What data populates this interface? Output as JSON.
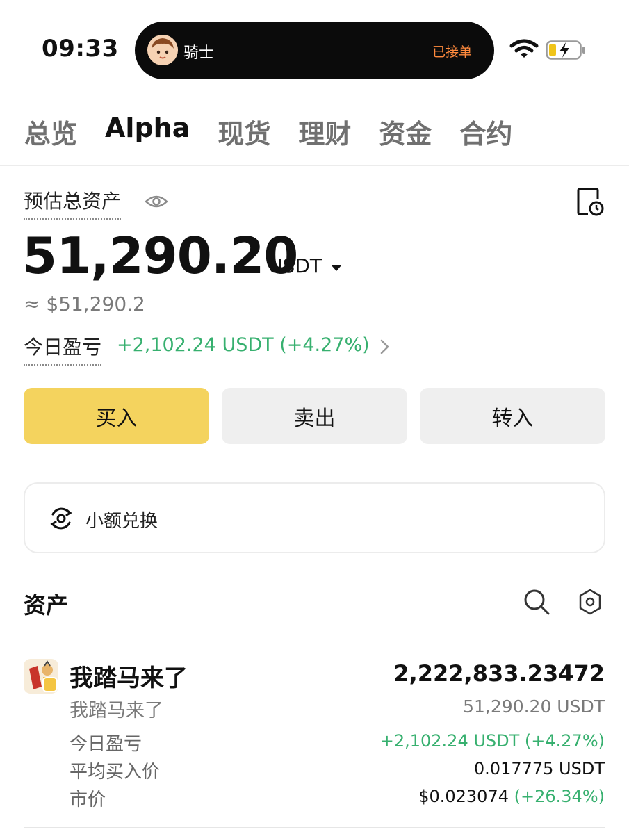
{
  "status_bar": {
    "time": "09:33",
    "island_name": "骑士",
    "island_status": "已接单",
    "island_status_color": "#ff8a3d"
  },
  "tabs": [
    {
      "label": "总览",
      "active": false
    },
    {
      "label": "Alpha",
      "active": true
    },
    {
      "label": "现货",
      "active": false
    },
    {
      "label": "理财",
      "active": false
    },
    {
      "label": "资金",
      "active": false
    },
    {
      "label": "合约",
      "active": false
    }
  ],
  "summary": {
    "label": "预估总资产",
    "amount": "51,290.20",
    "unit": "USDT",
    "approx": "≈ $51,290.2",
    "pnl_label": "今日盈亏",
    "pnl_value": "+2,102.24 USDT (+4.27%)",
    "icons": [
      "eye-icon",
      "history-icon",
      "chevron-right-icon"
    ]
  },
  "actions": {
    "buy": "买入",
    "sell": "卖出",
    "transfer": "转入",
    "buy_color": "#f4d35e"
  },
  "exchange": {
    "label": "小额兑换",
    "icon": "exchange-icon"
  },
  "assets": {
    "title": "资产",
    "icons": [
      "search-icon",
      "settings-icon"
    ],
    "items": [
      {
        "name": "我踏马来了",
        "subtitle": "我踏马来了",
        "quantity": "2,222,833.23472",
        "value": "51,290.20 USDT",
        "pnl_label": "今日盈亏",
        "pnl_value": "+2,102.24 USDT (+4.27%)",
        "avg_label": "平均买入价",
        "avg_value": "0.017775 USDT",
        "price_label": "市价",
        "price_value": "$0.023074",
        "price_change": "(+26.34%)"
      }
    ]
  },
  "colors": {
    "positive": "#37b06f",
    "muted": "#7a7a7a"
  }
}
